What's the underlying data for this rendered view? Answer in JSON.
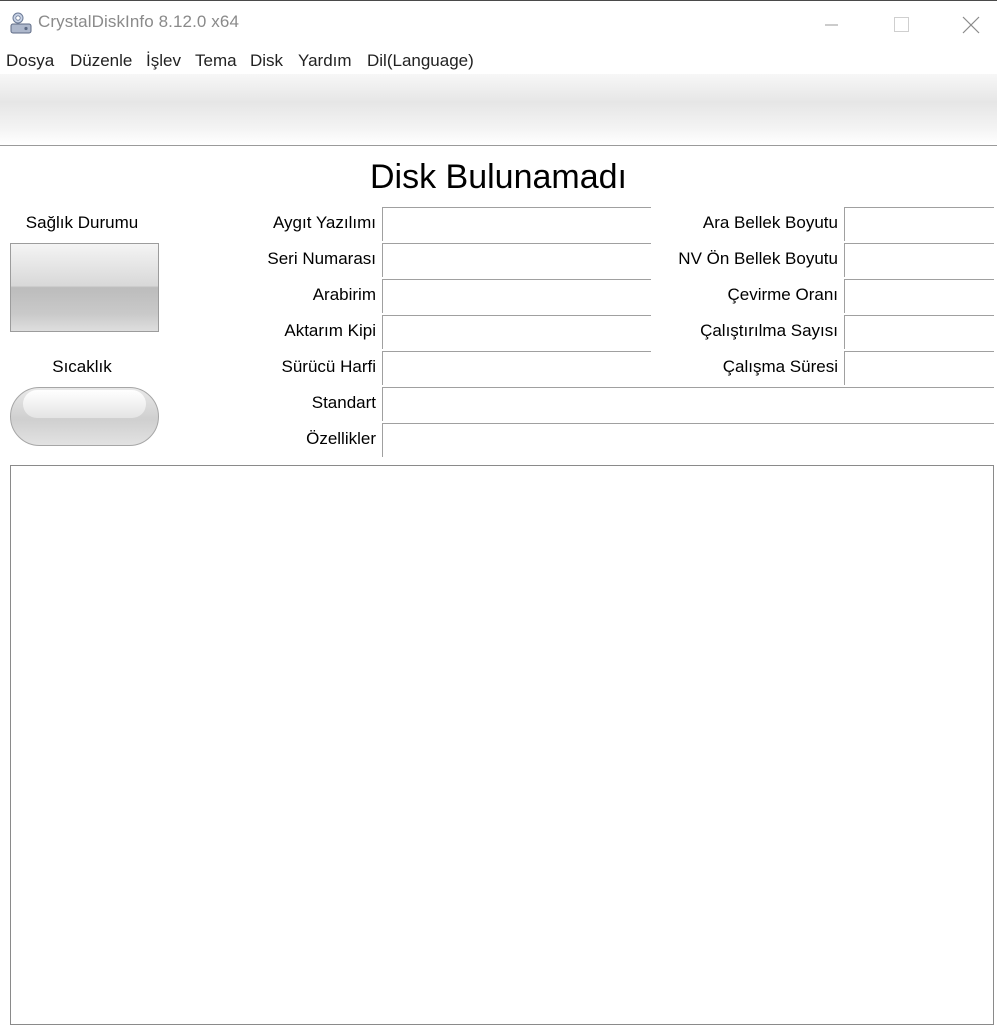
{
  "window": {
    "title": "CrystalDiskInfo 8.12.0 x64",
    "icons": {
      "app": "crystaldiskinfo-icon",
      "minimize": "minimize-icon",
      "maximize": "maximize-icon",
      "close": "close-icon"
    }
  },
  "menu": {
    "items": [
      {
        "label": "Dosya"
      },
      {
        "label": "Düzenle"
      },
      {
        "label": "İşlev"
      },
      {
        "label": "Tema"
      },
      {
        "label": "Disk"
      },
      {
        "label": "Yardım"
      },
      {
        "label": "Dil(Language)"
      }
    ]
  },
  "main": {
    "disk_title": "Disk Bulunamadı",
    "health": {
      "label": "Sağlık Durumu",
      "value": ""
    },
    "temperature": {
      "label": "Sıcaklık",
      "value": ""
    },
    "left_fields": [
      {
        "label": "Aygıt Yazılımı",
        "value": ""
      },
      {
        "label": "Seri Numarası",
        "value": ""
      },
      {
        "label": "Arabirim",
        "value": ""
      },
      {
        "label": "Aktarım Kipi",
        "value": ""
      },
      {
        "label": "Sürücü Harfi",
        "value": ""
      }
    ],
    "right_fields": [
      {
        "label": "Ara Bellek Boyutu",
        "value": ""
      },
      {
        "label": "NV Ön Bellek Boyutu",
        "value": ""
      },
      {
        "label": "Çevirme Oranı",
        "value": ""
      },
      {
        "label": "Çalıştırılma Sayısı",
        "value": ""
      },
      {
        "label": "Çalışma Süresi",
        "value": ""
      }
    ],
    "wide_fields": [
      {
        "label": "Standart",
        "value": ""
      },
      {
        "label": "Özellikler",
        "value": ""
      }
    ]
  }
}
